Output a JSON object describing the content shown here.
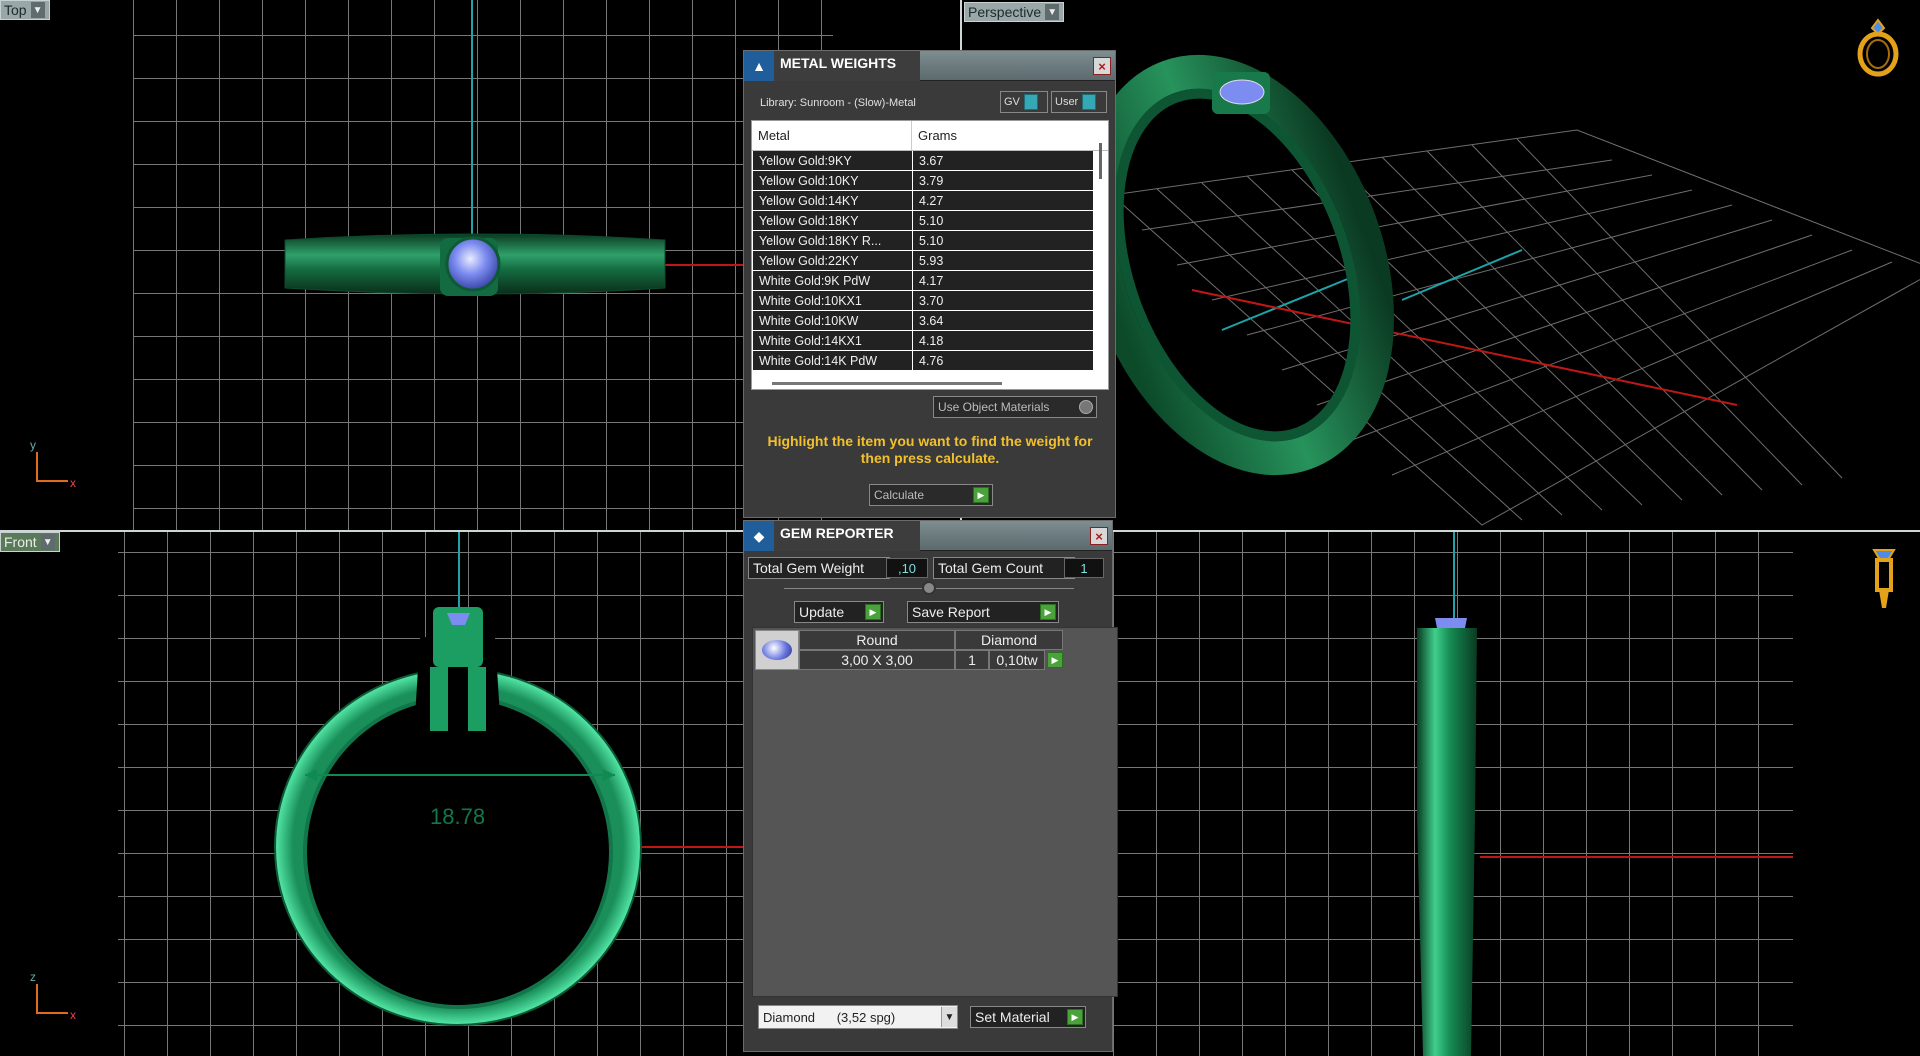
{
  "viewports": {
    "top": {
      "label": "Top"
    },
    "perspective": {
      "label": "Perspective"
    },
    "front": {
      "label": "Front"
    },
    "dropdown_icon": "chevron-down-icon"
  },
  "axes": {
    "y": "y",
    "x": "x",
    "z": "z"
  },
  "front_dimension": "18.78",
  "metal_weights": {
    "title": "METAL WEIGHTS",
    "library": "Library: Sunroom - (Slow)-Metal",
    "toggle_gv": "GV",
    "toggle_user": "User",
    "columns": [
      "Metal",
      "Grams"
    ],
    "rows": [
      [
        "Yellow Gold:9KY",
        "3.67"
      ],
      [
        "Yellow Gold:10KY",
        "3.79"
      ],
      [
        "Yellow Gold:14KY",
        "4.27"
      ],
      [
        "Yellow Gold:18KY",
        "5.10"
      ],
      [
        "Yellow Gold:18KY R...",
        "5.10"
      ],
      [
        "Yellow Gold:22KY",
        "5.93"
      ],
      [
        "White Gold:9K PdW",
        "4.17"
      ],
      [
        "White Gold:10KX1",
        "3.70"
      ],
      [
        "White Gold:10KW",
        "3.64"
      ],
      [
        "White Gold:14KX1",
        "4.18"
      ],
      [
        "White Gold:14K PdW",
        "4.76"
      ]
    ],
    "use_object_materials": "Use Object Materials",
    "hint": "Highlight the item you want to find the weight for then press calculate.",
    "calculate": "Calculate",
    "close": "×"
  },
  "gem_reporter": {
    "title": "GEM REPORTER",
    "total_weight_label": "Total Gem Weight",
    "total_weight_value": ",10",
    "total_count_label": "Total Gem Count",
    "total_count_value": "1",
    "update": "Update",
    "save_report": "Save Report",
    "gem": {
      "shape": "Round",
      "material": "Diamond",
      "size": "3,00 X 3,00",
      "count": "1",
      "weight": "0,10tw"
    },
    "material_select": "Diamond      (3,52 spg)",
    "set_material": "Set Material",
    "close": "×"
  },
  "colors": {
    "metal_green": "#1f7a4a",
    "gem_blue": "#6f7fe6",
    "axis_cyan": "#1da3a8",
    "axis_red": "#c01616",
    "hint_yellow": "#f2c02c",
    "go_green": "#4aa23a"
  }
}
